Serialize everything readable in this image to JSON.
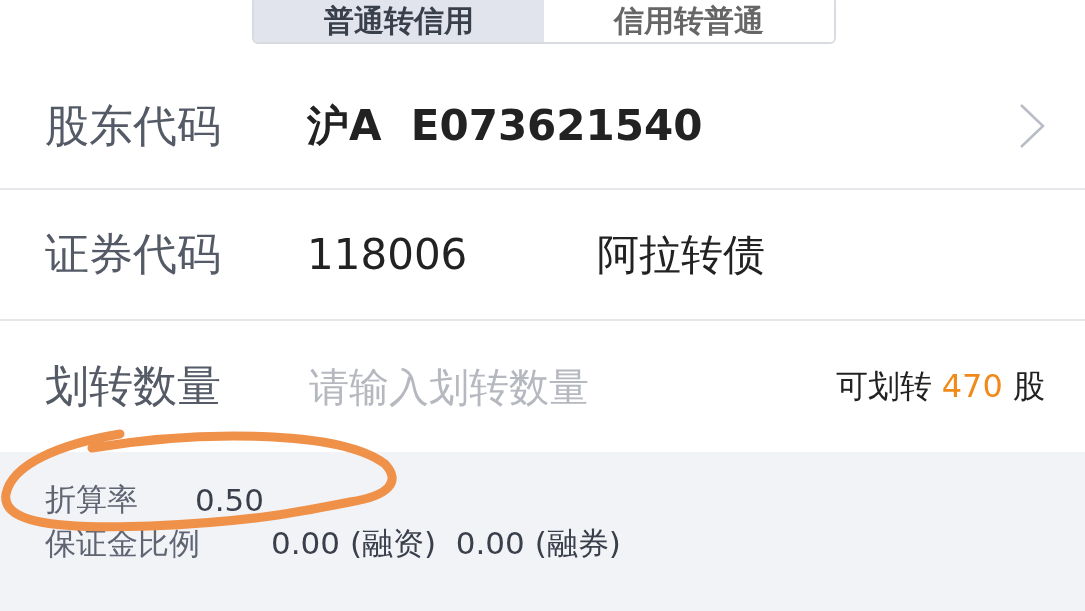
{
  "tabs": [
    {
      "label": "普通转信用",
      "selected": true
    },
    {
      "label": "信用转普通",
      "selected": false
    }
  ],
  "form": {
    "shareholder_code": {
      "label": "股东代码",
      "value": "沪A  E073621540"
    },
    "security_code": {
      "label": "证券代码",
      "code": "118006",
      "name": "阿拉转债"
    },
    "quantity": {
      "label": "划转数量",
      "placeholder": "请输入划转数量",
      "available_prefix": "可划转",
      "available_amount": "470",
      "available_unit": "股"
    }
  },
  "info": {
    "rate_label": "折算率",
    "rate_value": "0.50",
    "margin_label": "保证金比例",
    "margin_value": "0.00 (融资)  0.00 (融券)"
  }
}
